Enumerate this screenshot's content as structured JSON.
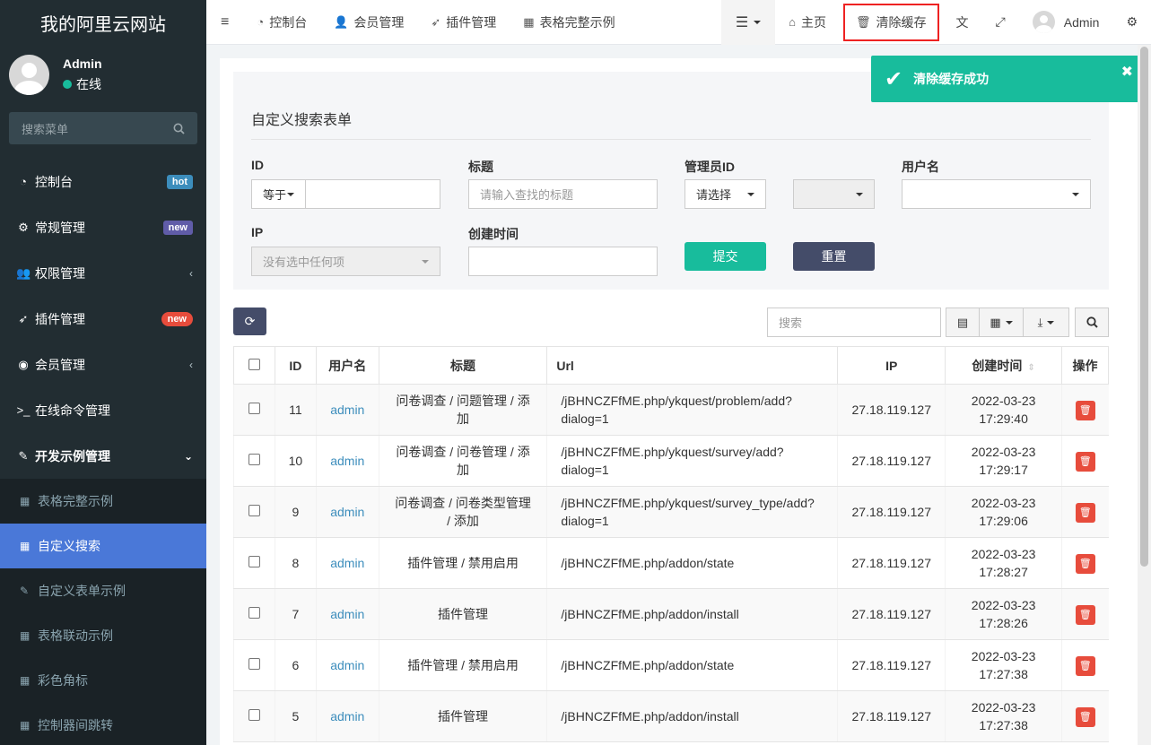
{
  "app": {
    "logo": "我的阿里云网站"
  },
  "user": {
    "name": "Admin",
    "status": "在线"
  },
  "sidebar": {
    "search_placeholder": "搜索菜单",
    "items": [
      {
        "label": "控制台",
        "icon": "dashboard-icon",
        "badge": "hot"
      },
      {
        "label": "常规管理",
        "icon": "cogs-icon",
        "badge": "new"
      },
      {
        "label": "权限管理",
        "icon": "users-icon"
      },
      {
        "label": "插件管理",
        "icon": "rocket-icon",
        "badge": "new"
      },
      {
        "label": "会员管理",
        "icon": "user-circle-icon"
      },
      {
        "label": "在线命令管理",
        "icon": "terminal-icon"
      },
      {
        "label": "开发示例管理",
        "icon": "magic-icon"
      }
    ],
    "subitems": [
      {
        "label": "表格完整示例"
      },
      {
        "label": "自定义搜索"
      },
      {
        "label": "自定义表单示例"
      },
      {
        "label": "表格联动示例"
      },
      {
        "label": "彩色角标"
      },
      {
        "label": "控制器间跳转"
      }
    ]
  },
  "header": {
    "tabs": [
      {
        "label": "控制台"
      },
      {
        "label": "会员管理"
      },
      {
        "label": "插件管理"
      },
      {
        "label": "表格完整示例"
      }
    ],
    "home": "主页",
    "clear_cache": "清除缓存",
    "user": "Admin"
  },
  "toast": {
    "message": "清除缓存成功"
  },
  "search_form": {
    "title": "自定义搜索表单",
    "id_label": "ID",
    "id_op": "等于",
    "title_label": "标题",
    "title_placeholder": "请输入查找的标题",
    "admin_label": "管理员ID",
    "admin_select": "请选择",
    "username_label": "用户名",
    "ip_label": "IP",
    "ip_placeholder": "没有选中任何项",
    "created_label": "创建时间",
    "submit": "提交",
    "reset": "重置"
  },
  "toolbar": {
    "search_placeholder": "搜索"
  },
  "table": {
    "headers": [
      "ID",
      "用户名",
      "标题",
      "Url",
      "IP",
      "创建时间",
      "操作"
    ],
    "rows": [
      {
        "id": "11",
        "user": "admin",
        "title": "问卷调查 / 问题管理 / 添加",
        "url": "/jBHNCZFfME.php/ykquest/problem/add?dialog=1",
        "ip": "27.18.119.127",
        "date": "2022-03-23",
        "time": "17:29:40"
      },
      {
        "id": "10",
        "user": "admin",
        "title": "问卷调查 / 问卷管理 / 添加",
        "url": "/jBHNCZFfME.php/ykquest/survey/add?dialog=1",
        "ip": "27.18.119.127",
        "date": "2022-03-23",
        "time": "17:29:17"
      },
      {
        "id": "9",
        "user": "admin",
        "title": "问卷调查 / 问卷类型管理 / 添加",
        "url": "/jBHNCZFfME.php/ykquest/survey_type/add?dialog=1",
        "ip": "27.18.119.127",
        "date": "2022-03-23",
        "time": "17:29:06"
      },
      {
        "id": "8",
        "user": "admin",
        "title": "插件管理 / 禁用启用",
        "url": "/jBHNCZFfME.php/addon/state",
        "ip": "27.18.119.127",
        "date": "2022-03-23",
        "time": "17:28:27"
      },
      {
        "id": "7",
        "user": "admin",
        "title": "插件管理",
        "url": "/jBHNCZFfME.php/addon/install",
        "ip": "27.18.119.127",
        "date": "2022-03-23",
        "time": "17:28:26"
      },
      {
        "id": "6",
        "user": "admin",
        "title": "插件管理 / 禁用启用",
        "url": "/jBHNCZFfME.php/addon/state",
        "ip": "27.18.119.127",
        "date": "2022-03-23",
        "time": "17:27:38"
      },
      {
        "id": "5",
        "user": "admin",
        "title": "插件管理",
        "url": "/jBHNCZFfME.php/addon/install",
        "ip": "27.18.119.127",
        "date": "2022-03-23",
        "time": "17:27:38"
      }
    ]
  }
}
